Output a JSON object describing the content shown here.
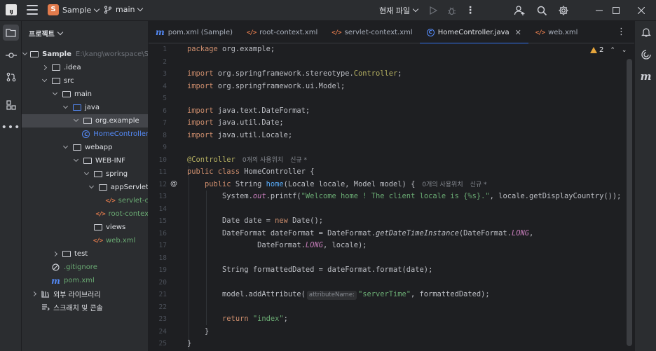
{
  "titlebar": {
    "project_initial": "S",
    "project_name": "Sample",
    "branch": "main",
    "run_config": "현재 파일"
  },
  "project_panel": {
    "title": "프로젝트",
    "tree": [
      {
        "label": "Sample",
        "hint": "E:\\kang\\workspace\\S",
        "level": 0,
        "arrow": "down",
        "icon": "module-folder",
        "bold": true
      },
      {
        "label": ".idea",
        "level": 1,
        "arrow": "right",
        "icon": "folder"
      },
      {
        "label": "src",
        "level": 1,
        "arrow": "down",
        "icon": "folder"
      },
      {
        "label": "main",
        "level": 2,
        "arrow": "down",
        "icon": "folder"
      },
      {
        "label": "java",
        "level": 3,
        "arrow": "down",
        "icon": "folder-blue"
      },
      {
        "label": "org.example",
        "level": 4,
        "arrow": "down",
        "icon": "package",
        "selected": true
      },
      {
        "label": "HomeController",
        "level": 5,
        "arrow": "",
        "icon": "class",
        "color": "#548af7"
      },
      {
        "label": "webapp",
        "level": 3,
        "arrow": "down",
        "icon": "folder"
      },
      {
        "label": "WEB-INF",
        "level": 4,
        "arrow": "down",
        "icon": "folder"
      },
      {
        "label": "spring",
        "level": 5,
        "arrow": "down",
        "icon": "folder"
      },
      {
        "label": "appServlet",
        "level": 6,
        "arrow": "down",
        "icon": "folder"
      },
      {
        "label": "servlet-c",
        "level": 7,
        "arrow": "",
        "icon": "xml",
        "color": "#6aab73"
      },
      {
        "label": "root-contex",
        "level": 6,
        "arrow": "",
        "icon": "xml",
        "color": "#6aab73"
      },
      {
        "label": "views",
        "level": 5,
        "arrow": "",
        "icon": "folder"
      },
      {
        "label": "web.xml",
        "level": 5,
        "arrow": "",
        "icon": "xml",
        "color": "#6aab73"
      },
      {
        "label": "test",
        "level": 2,
        "arrow": "right",
        "icon": "folder"
      },
      {
        "label": ".gitignore",
        "level": 1,
        "arrow": "",
        "icon": "ignore",
        "color": "#6aab73"
      },
      {
        "label": "pom.xml",
        "level": 1,
        "arrow": "",
        "icon": "maven",
        "color": "#6aab73"
      },
      {
        "label": "외부 라이브러리",
        "level": 0,
        "arrow": "right",
        "icon": "library"
      },
      {
        "label": "스크래치 및 콘솔",
        "level": 0,
        "arrow": "",
        "icon": "scratch"
      }
    ]
  },
  "tabs": [
    {
      "label": "pom.xml (Sample)",
      "icon": "maven"
    },
    {
      "label": "root-context.xml",
      "icon": "xml"
    },
    {
      "label": "servlet-context.xml",
      "icon": "xml"
    },
    {
      "label": "HomeController.java",
      "icon": "class",
      "active": true
    },
    {
      "label": "web.xml",
      "icon": "xml"
    }
  ],
  "editor": {
    "warnings_count": "2",
    "line_numbers": [
      "1",
      "2",
      "3",
      "4",
      "5",
      "6",
      "7",
      "8",
      "9",
      "10",
      "11",
      "12",
      "13",
      "14",
      "15",
      "16",
      "17",
      "18",
      "19",
      "20",
      "21",
      "22",
      "23",
      "24",
      "25"
    ],
    "hints": {
      "class_usages": "0개의 사용위치",
      "class_new": "신규 *",
      "method_usages": "0개의 사용위치",
      "method_new": "신규 *",
      "param_name": "attributeName:"
    },
    "code": {
      "l1_kw": "package",
      "l1_rest": " org.example;",
      "l3_kw": "import",
      "l3_rest": " org.springframework.stereotype.",
      "l3_cls": "Controller",
      "l3_end": ";",
      "l4_kw": "import",
      "l4_rest": " org.springframework.ui.Model;",
      "l6_kw": "import",
      "l6_rest": " java.text.DateFormat;",
      "l7_kw": "import",
      "l7_rest": " java.util.Date;",
      "l8_kw": "import",
      "l8_rest": " java.util.Locale;",
      "l10_ann": "@Controller",
      "l11_kw": "public class",
      "l11_name": "HomeController",
      "l11_end": " {",
      "l12_kw": "public",
      "l12_type": " String ",
      "l12_fn": "home",
      "l12_params": "(Locale locale, Model model) {",
      "l13_a": "System.",
      "l13_out": "out",
      "l13_b": ".printf(",
      "l13_str": "\"Welcome home ! The client locale is {%s}.\"",
      "l13_c": ", locale.getDisplayCountry());",
      "l15_a": "Date date = ",
      "l15_kw": "new",
      "l15_b": " Date();",
      "l16_a": "DateFormat dateFormat = DateFormat.",
      "l16_fn": "getDateTimeInstance",
      "l16_b": "(DateFormat.",
      "l16_sf": "LONG",
      "l16_c": ",",
      "l17_a": "DateFormat.",
      "l17_sf": "LONG",
      "l17_b": ", locale);",
      "l19_a": "String formattedDated = dateFormat.format(date);",
      "l21_a": "model.addAttribute(",
      "l21_str": "\"serverTime\"",
      "l21_b": ", formattedDated);",
      "l23_kw": "return",
      "l23_str": " \"index\"",
      "l23_end": ";",
      "l24": "}",
      "l25": "}"
    }
  }
}
